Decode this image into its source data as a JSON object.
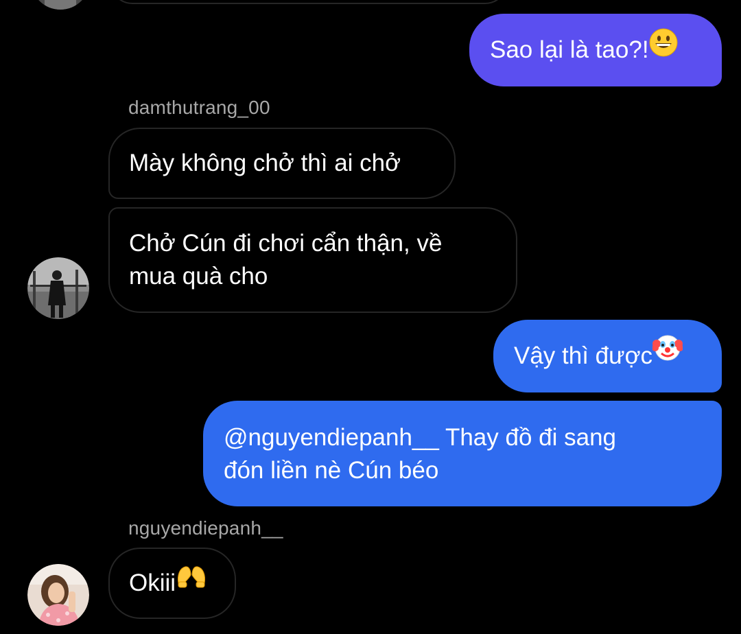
{
  "colors": {
    "background": "#000000",
    "outgoing_purple": "#5b4ff0",
    "outgoing_blue": "#2f6bef",
    "incoming_border": "#262626",
    "sender_name": "#a8a8a8"
  },
  "messages": [
    {
      "id": "m1",
      "direction": "out",
      "text": "Sao lại là tao?!",
      "emoji": "grinning-face-emoji"
    },
    {
      "id": "m2",
      "direction": "in",
      "sender": "damthutrang_00",
      "text": "Mày không chở thì ai chở"
    },
    {
      "id": "m3",
      "direction": "in",
      "text_lines": [
        "Chở Cún đi chơi cẩn thận, về",
        "mua quà cho"
      ]
    },
    {
      "id": "m4",
      "direction": "out",
      "text": "Vậy thì được",
      "emoji": "clown-face-emoji"
    },
    {
      "id": "m5",
      "direction": "out",
      "text_lines": [
        "@nguyendiepanh__ Thay đồ đi sang",
        "đón liền nè Cún béo"
      ]
    },
    {
      "id": "m6",
      "direction": "in",
      "sender": "nguyendiepanh__",
      "text": "Okiii",
      "emoji": "heart-hands-emoji"
    }
  ]
}
